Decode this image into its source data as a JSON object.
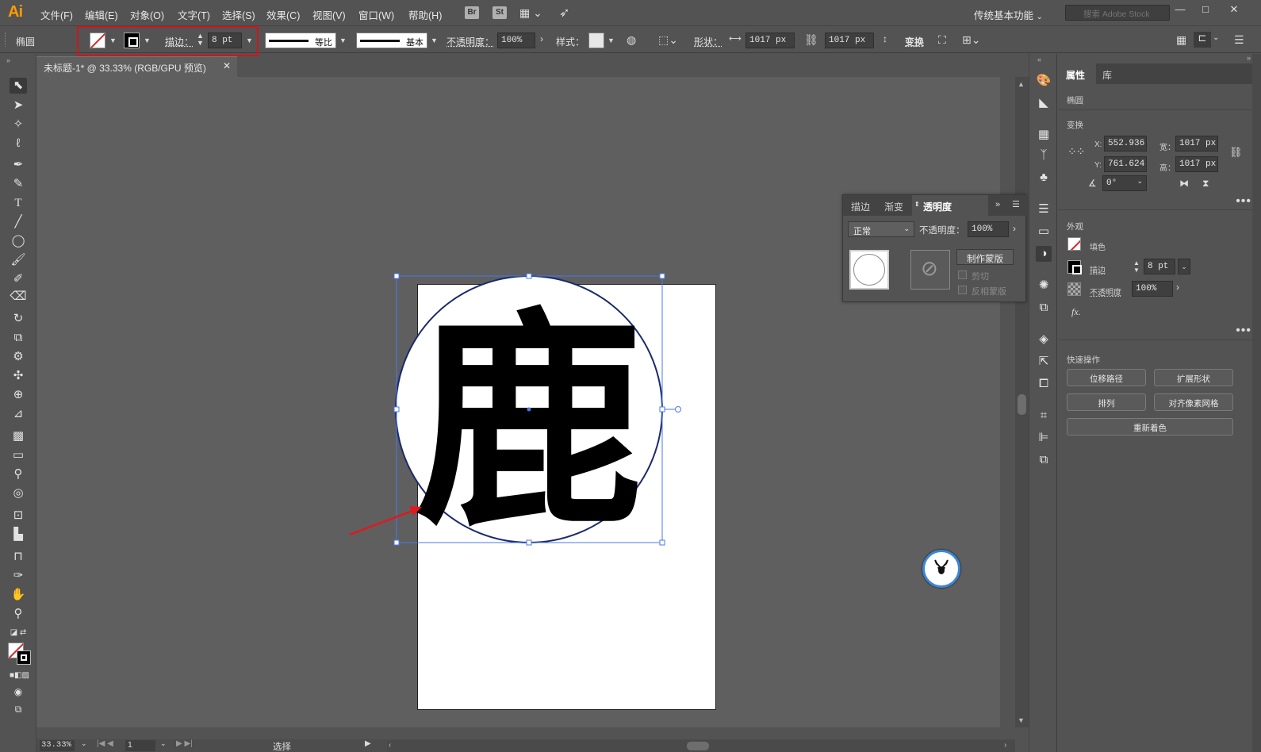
{
  "app": {
    "logo": "Ai",
    "menus": [
      "文件(F)",
      "编辑(E)",
      "对象(O)",
      "文字(T)",
      "选择(S)",
      "效果(C)",
      "视图(V)",
      "窗口(W)",
      "帮助(H)"
    ],
    "bridge_badge": "Br",
    "stock_badge": "St",
    "workspace": "传统基本功能",
    "stock_search_placeholder": "搜索 Adobe Stock",
    "window_controls": [
      "—",
      "□",
      "✕"
    ]
  },
  "controlbar": {
    "object_type": "椭圆",
    "stroke_label": "描边：",
    "stroke_weight": "8 pt",
    "stroke_profile": "等比",
    "brush": "基本",
    "opacity_label": "不透明度：",
    "opacity_value": "100%",
    "style_label": "样式：",
    "shape_label": "形状：",
    "width_value": "1017 px",
    "height_value": "1017 px",
    "transform_label": "变换"
  },
  "document": {
    "tab_title": "未标题-1* @ 33.33% (RGB/GPU 预览)",
    "close": "✕",
    "artwork_glyph": "鹿"
  },
  "transparency_panel": {
    "tabs": [
      "描边",
      "渐变",
      "透明度"
    ],
    "blend_mode": "正常",
    "opacity_label": "不透明度：",
    "opacity_value": "100%",
    "make_mask_button": "制作蒙版",
    "clip_label": "剪切",
    "invert_mask_label": "反相蒙版"
  },
  "properties_panel": {
    "tabs": [
      "属性",
      "库"
    ],
    "object_type": "椭圆",
    "transform_title": "变换",
    "x_label": "X:",
    "x_value": "552.936",
    "y_label": "Y:",
    "y_value": "761.624",
    "w_label": "宽：",
    "w_value": "1017 px",
    "h_label": "高：",
    "h_value": "1017 px",
    "angle_value": "0°",
    "appearance_title": "外观",
    "fill_label": "填色",
    "stroke_label": "描边",
    "stroke_value": "8 pt",
    "opacity_label": "不透明度",
    "opacity_value": "100%",
    "fx_label": "fx.",
    "quick_actions_title": "快速操作",
    "quick_actions": [
      "位移路径",
      "扩展形状",
      "排列",
      "对齐像素网格",
      "重新着色"
    ]
  },
  "status": {
    "zoom": "33.33%",
    "artboard_number": "1",
    "tool_status": "选择"
  },
  "colors": {
    "accent_red": "#d0161b",
    "selection_blue": "#4a7ae8",
    "circle_stroke": "#1b2a6b"
  }
}
